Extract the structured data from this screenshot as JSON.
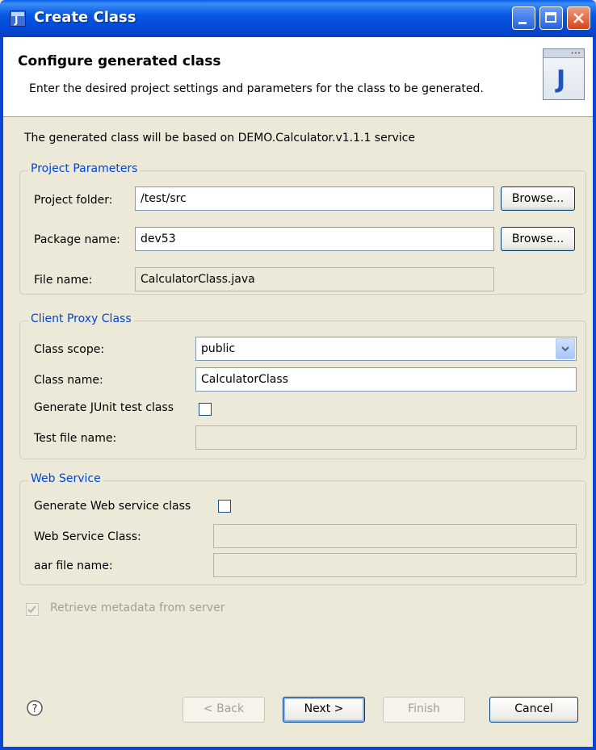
{
  "window": {
    "title": "Create Class"
  },
  "banner": {
    "title": "Configure generated class",
    "description": "Enter the desired project settings and parameters for the class to be generated."
  },
  "intro_text": "The generated class will be based on DEMO.Calculator.v1.1.1 service",
  "project_parameters": {
    "legend": "Project Parameters",
    "project_folder_label": "Project folder:",
    "project_folder_value": "/test/src",
    "package_name_label": "Package name:",
    "package_name_value": "dev53",
    "file_name_label": "File name:",
    "file_name_value": "CalculatorClass.java",
    "browse_label": "Browse..."
  },
  "client_proxy": {
    "legend": "Client Proxy Class",
    "class_scope_label": "Class scope:",
    "class_scope_value": "public",
    "class_name_label": "Class name:",
    "class_name_value": "CalculatorClass",
    "generate_junit_label": "Generate JUnit test class",
    "generate_junit_checked": false,
    "test_file_label": "Test file name:",
    "test_file_value": ""
  },
  "web_service": {
    "legend": "Web Service",
    "generate_ws_label": "Generate Web service class",
    "generate_ws_checked": false,
    "ws_class_label": "Web Service Class:",
    "ws_class_value": "",
    "aar_label": "aar file name:",
    "aar_value": ""
  },
  "retrieve_metadata": {
    "label": "Retrieve metadata from server",
    "checked": true,
    "enabled": false
  },
  "footer": {
    "back_label": "< Back",
    "next_label": "Next >",
    "finish_label": "Finish",
    "cancel_label": "Cancel"
  },
  "colors": {
    "titlebar": "#0a5fe8",
    "dialog_bg": "#ece9d8",
    "legend": "#0046d5"
  }
}
